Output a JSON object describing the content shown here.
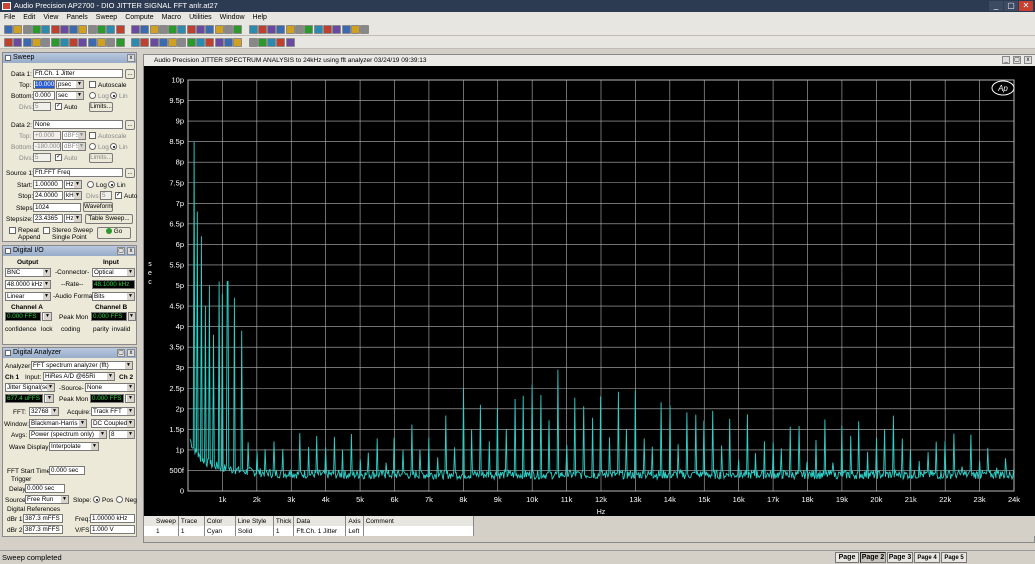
{
  "window": {
    "title": "Audio Precision AP2700 - DIO JITTER SIGNAL FFT anlr.at27",
    "min": "_",
    "max": "▢",
    "close": "✕"
  },
  "menu": [
    "File",
    "Edit",
    "View",
    "Panels",
    "Sweep",
    "Compute",
    "Macro",
    "Utilities",
    "Window",
    "Help"
  ],
  "sweep_panel": {
    "title": "Sweep",
    "data1_label": "Data 1:",
    "data1_value": "Fft.Ch. 1 Jitter",
    "top_label": "Top:",
    "top_value": "10.000",
    "top_unit": "psec",
    "autoscale": "Autoscale",
    "bottom_label": "Bottom:",
    "bottom_value": "0.000",
    "bottom_unit": "sec",
    "log": "Log",
    "lin": "Lin",
    "divs_label": "Divs:",
    "divs_value": "5",
    "auto": "Auto",
    "limits": "Limits...",
    "data2_label": "Data 2:",
    "data2_value": "None",
    "top2_value": "+0.000",
    "top2_unit": "dBFS",
    "bottom2_value": "-180.000",
    "bottom2_unit": "dBFS",
    "divs2_value": "5",
    "source1_label": "Source 1:",
    "source1_value": "Fft.FFT Freq",
    "start_label": "Start:",
    "start_value": "1.00000",
    "start_unit": "Hz",
    "stop_label": "Stop:",
    "stop_value": "24.0000",
    "stop_unit": "kHz",
    "divs3_label": "Divs:",
    "divs3_value": "5",
    "steps_label": "Steps:",
    "steps_value": "1024",
    "waveform": "Waveform",
    "stepsize_label": "Stepsize:",
    "stepsize_value": "23.4365",
    "stepsize_unit": "Hz",
    "table_sweep": "Table Sweep...",
    "repeat": "Repeat",
    "append": "Append",
    "stereo_sweep": "Stereo Sweep",
    "single_point": "Single Point",
    "go": "Go"
  },
  "dio_panel": {
    "title": "Digital I/O",
    "output": "Output",
    "input": "Input",
    "connector_out": "BNC",
    "connector_label": "-Connector-",
    "connector_in": "Optical",
    "rate_out": "48.0000 kHz",
    "rate_label": "--Rate--",
    "rate_in": "48.1000 kHz",
    "format_out": "Linear",
    "format_label": "-Audio Format-",
    "format_in": "Bits",
    "chA": "Channel A",
    "chB": "Channel B",
    "chA_value": "0.000",
    "chA_unit": "FFS",
    "peak_mon": "Peak Mon",
    "chB_value": "0.000",
    "chB_unit": "FFS",
    "status": [
      "confidence",
      "lock",
      "coding",
      "parity",
      "invalid"
    ]
  },
  "analyzer_panel": {
    "title": "Digital Analyzer",
    "analyzer_label": "Analyzer:",
    "analyzer_value": "FFT spectrum analyzer (fft)",
    "ch1": "Ch 1",
    "input_label": "Input:",
    "input_value": "HiRes A/D @65Ri",
    "ch2": "Ch 2",
    "jitter_value": "Jitter Signal(sec)",
    "source_label": "-Source-",
    "source_value": "None",
    "reading1_value": "677.4",
    "reading1_unit": "uFFS",
    "peak_mon": "Peak Mon",
    "reading2_value": "0.000",
    "reading2_unit": "FFS",
    "fft_label": "FFT:",
    "fft_value": "32768",
    "acquire_label": "Acquire:",
    "acquire_value": "Track FFT",
    "window_label": "Window:",
    "window_value": "Blackman-Harris",
    "coupling_value": "DC Coupled",
    "avgs_label": "Avgs:",
    "avgs_mode": "Power (spectrum only)",
    "avgs_value": "8",
    "wave_label": "Wave Display:",
    "wave_value": "Interpolate",
    "fft_start_label": "FFT Start Time:",
    "fft_start_value": "0.000",
    "fft_start_unit": "sec",
    "trigger_label": "Trigger",
    "delay_label": "Delay:",
    "delay_value": "0.000",
    "delay_unit": "sec",
    "source2_label": "Source:",
    "source2_value": "Free Run",
    "slope_label": "Slope:",
    "pos": "Pos",
    "neg": "Neg",
    "dref_label": "Digital References",
    "dbr1_label": "dBr 1:",
    "dbr1_value": "387.3",
    "dbr1_unit": "mFFS",
    "freq_label": "Freq:",
    "freq_value": "1.00000",
    "freq_unit": "kHz",
    "dbr2_label": "dBr 2:",
    "dbr2_value": "387.3",
    "dbr2_unit": "mFFS",
    "vfs_label": "V/FS:",
    "vfs_value": "1.000",
    "vfs_unit": "V"
  },
  "graph": {
    "header": "Audio Precision  JITTER SPECTRUM ANALYSIS to 24kHz using fft analyzer           03/24/19 09:39:13",
    "logo": "Ap",
    "legend_headers": [
      "Sweep",
      "Trace",
      "Color",
      "Line Style",
      "Thick",
      "Data",
      "Axis",
      "Comment"
    ],
    "legend_row": [
      "1",
      "1",
      "Cyan",
      "Solid",
      "1",
      "Fft.Ch. 1 Jitter",
      "Left",
      ""
    ]
  },
  "status": {
    "text": "Sweep completed",
    "pages": [
      "Page 1",
      "Page 2",
      "Page 3",
      "Page 4",
      "Page 5"
    ],
    "active_page": 1
  },
  "colors": {
    "trace": "#2fd0c8",
    "grid": "#b8b8b8",
    "plot_bg": "#000000",
    "lcd": "#2fd03a"
  },
  "chart_data": {
    "type": "line",
    "xlabel": "Hz",
    "ylabel": "s e c",
    "xlim": [
      0,
      24000
    ],
    "ylim": [
      0,
      10
    ],
    "x_ticks": [
      "1k",
      "2k",
      "3k",
      "4k",
      "5k",
      "6k",
      "7k",
      "8k",
      "9k",
      "10k",
      "11k",
      "12k",
      "13k",
      "14k",
      "15k",
      "16k",
      "17k",
      "18k",
      "19k",
      "20k",
      "21k",
      "22k",
      "23k",
      "24k"
    ],
    "y_ticks": [
      "10p",
      "9.5p",
      "9p",
      "8.5p",
      "8p",
      "7.5p",
      "7p",
      "6.5p",
      "6p",
      "5.5p",
      "5p",
      "4.5p",
      "4p",
      "3.5p",
      "3p",
      "2.5p",
      "2p",
      "1.5p",
      "1p",
      "500f",
      "0"
    ],
    "noise_floor_p": 0.4,
    "low_freq_peaks": [
      {
        "x": 180,
        "y": 8.5
      },
      {
        "x": 260,
        "y": 6.8
      },
      {
        "x": 380,
        "y": 6.2
      },
      {
        "x": 500,
        "y": 4.5
      },
      {
        "x": 620,
        "y": 5.0
      },
      {
        "x": 750,
        "y": 3.8
      },
      {
        "x": 900,
        "y": 5.1
      },
      {
        "x": 1000,
        "y": 4.8
      },
      {
        "x": 1150,
        "y": 5.1
      },
      {
        "x": 1350,
        "y": 4.7
      },
      {
        "x": 1550,
        "y": 3.9
      }
    ],
    "spur_spacing_hz": 250,
    "spur_envelope": [
      {
        "x": 2000,
        "y": 1.6
      },
      {
        "x": 3000,
        "y": 1.5
      },
      {
        "x": 4000,
        "y": 1.4
      },
      {
        "x": 6000,
        "y": 1.6
      },
      {
        "x": 7000,
        "y": 1.8
      },
      {
        "x": 8000,
        "y": 2.6
      },
      {
        "x": 9000,
        "y": 3.0
      },
      {
        "x": 10000,
        "y": 3.1
      },
      {
        "x": 11000,
        "y": 3.2
      },
      {
        "x": 12000,
        "y": 3.1
      },
      {
        "x": 13000,
        "y": 2.8
      },
      {
        "x": 14000,
        "y": 2.2
      },
      {
        "x": 15000,
        "y": 2.0
      },
      {
        "x": 16000,
        "y": 2.1
      },
      {
        "x": 17000,
        "y": 1.6
      },
      {
        "x": 18000,
        "y": 1.8
      },
      {
        "x": 19000,
        "y": 1.9
      },
      {
        "x": 20000,
        "y": 2.0
      },
      {
        "x": 21000,
        "y": 1.9
      },
      {
        "x": 22000,
        "y": 1.8
      },
      {
        "x": 23000,
        "y": 1.5
      },
      {
        "x": 24000,
        "y": 1.4
      }
    ],
    "grid": true
  }
}
